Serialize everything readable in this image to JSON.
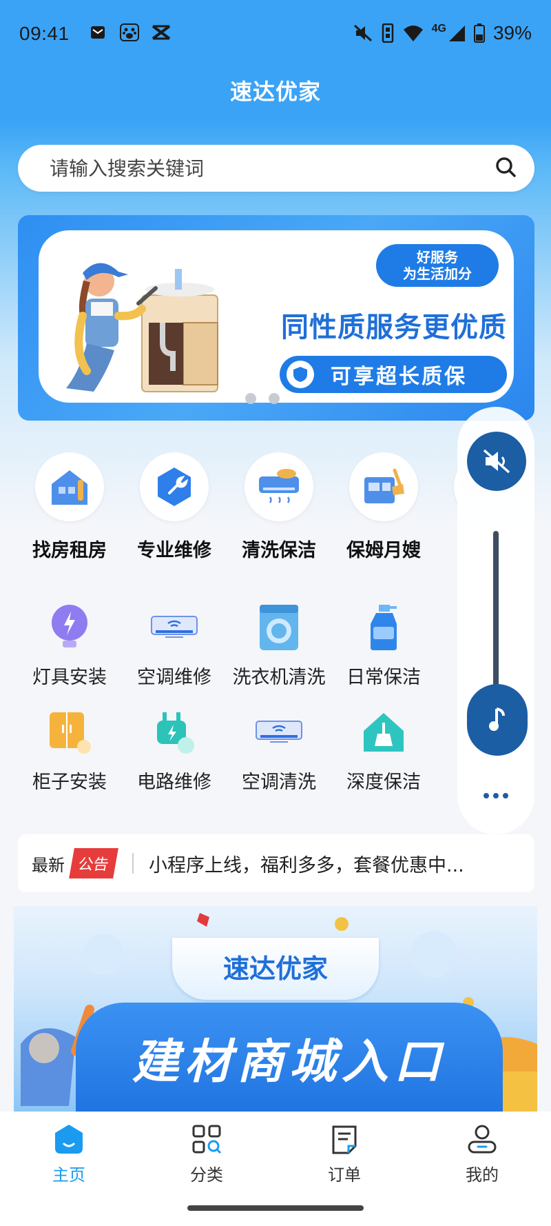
{
  "status_bar": {
    "time": "09:41",
    "network": "4G",
    "battery": "39%"
  },
  "header": {
    "title": "速达优家"
  },
  "search": {
    "placeholder": "请输入搜索关键词"
  },
  "banner": {
    "pill_line1": "好服务",
    "pill_line2": "为生活加分",
    "headline": "同性质服务更优质",
    "cta": "可享超长质保"
  },
  "categories": [
    {
      "label": "找房租房",
      "icon": "house-icon"
    },
    {
      "label": "专业维修",
      "icon": "wrench-icon"
    },
    {
      "label": "清洗保洁",
      "icon": "ac-cleaning-icon"
    },
    {
      "label": "保姆月嫂",
      "icon": "nanny-icon"
    }
  ],
  "services": [
    {
      "label": "灯具安装",
      "icon": "bulb-icon"
    },
    {
      "label": "空调维修",
      "icon": "air-conditioner-icon"
    },
    {
      "label": "洗衣机清洗",
      "icon": "washing-machine-icon"
    },
    {
      "label": "日常保洁",
      "icon": "spray-bottle-icon"
    },
    {
      "label": "柜子安装",
      "icon": "cabinet-icon"
    },
    {
      "label": "电路维修",
      "icon": "plug-icon"
    },
    {
      "label": "空调清洗",
      "icon": "air-conditioner-icon"
    },
    {
      "label": "深度保洁",
      "icon": "house-clean-icon"
    }
  ],
  "notice": {
    "prefix": "最新",
    "tag": "公告",
    "text": "小程序上线，福利多多，套餐优惠中..."
  },
  "mall_banner": {
    "brand": "速达优家",
    "title": "建材商城入口"
  },
  "tabbar": [
    {
      "label": "主页",
      "active": true
    },
    {
      "label": "分类",
      "active": false
    },
    {
      "label": "订单",
      "active": false
    },
    {
      "label": "我的",
      "active": false
    }
  ],
  "colors": {
    "primary": "#3aa3f6",
    "accent": "#1a9bf0",
    "notice_tag": "#e63c3c"
  }
}
